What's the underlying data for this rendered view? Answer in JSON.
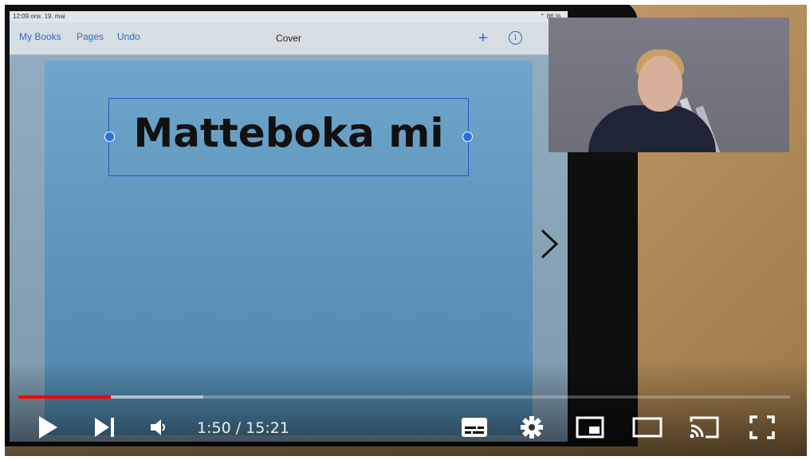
{
  "ipad": {
    "status_time": "12:09  ons. 19. mai",
    "status_battery": "⌃ 86 %",
    "nav": {
      "my_books": "My Books",
      "pages": "Pages",
      "undo": "Undo",
      "title": "Cover"
    },
    "cover_title": "Matteboka mi"
  },
  "player": {
    "current_time": "1:50",
    "duration": "15:21",
    "time_display": "1:50 / 15:21",
    "progress_played": 0.12,
    "progress_buffered": 0.24,
    "accent_color": "#ff0000"
  },
  "icons": {
    "play": "play-icon",
    "next": "next-icon",
    "volume": "volume-icon",
    "subtitles": "subtitles-icon",
    "settings": "gear-icon",
    "miniplayer": "miniplayer-icon",
    "theater": "theater-mode-icon",
    "cast": "cast-icon",
    "fullscreen": "fullscreen-icon"
  }
}
